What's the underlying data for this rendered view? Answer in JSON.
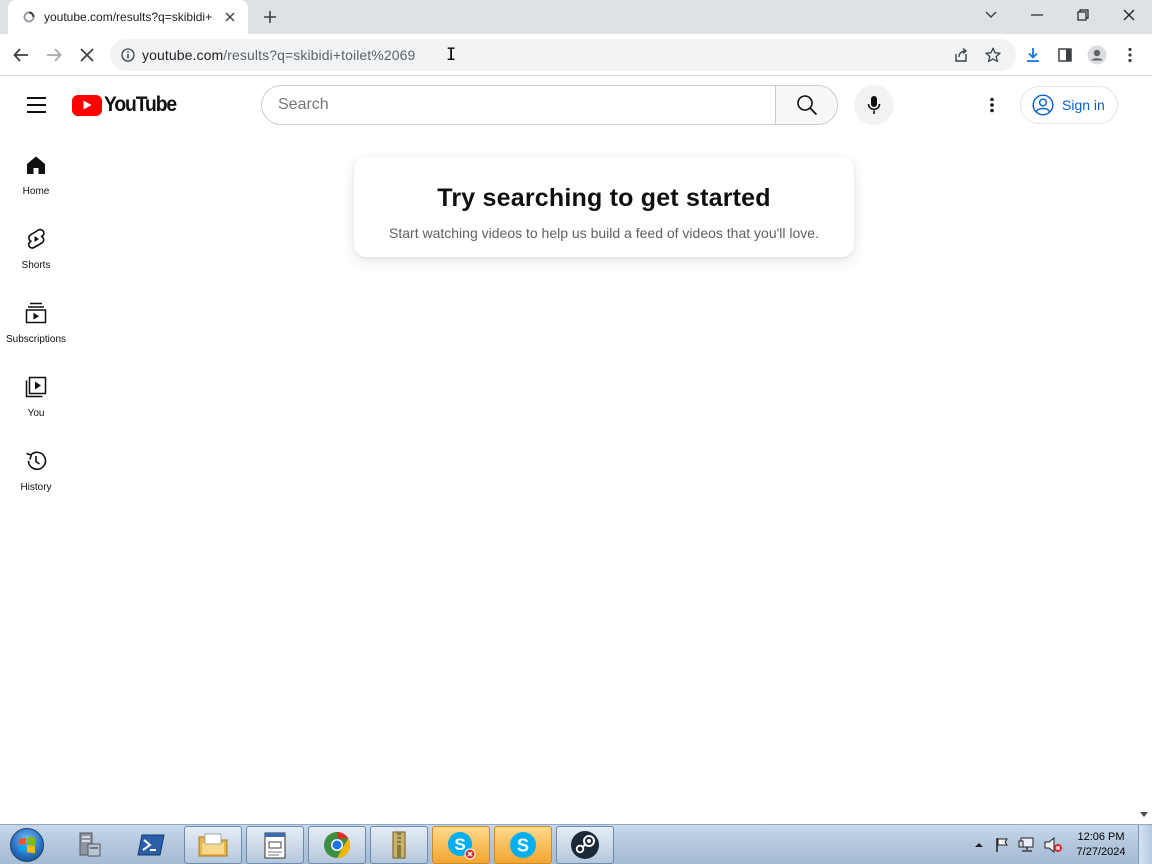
{
  "browser": {
    "tab": {
      "title": "youtube.com/results?q=skibidi+",
      "favicon": "loading-icon"
    },
    "url": {
      "host": "youtube.com",
      "path": "/results?q=skibidi+toilet%2069"
    }
  },
  "youtube": {
    "logo_text": "YouTube",
    "search": {
      "placeholder": "Search",
      "value": ""
    },
    "signin_label": "Sign in",
    "guide": [
      {
        "label": "Home",
        "icon": "home-icon"
      },
      {
        "label": "Shorts",
        "icon": "shorts-icon"
      },
      {
        "label": "Subscriptions",
        "icon": "subscriptions-icon"
      },
      {
        "label": "You",
        "icon": "you-icon"
      },
      {
        "label": "History",
        "icon": "history-icon"
      }
    ],
    "promo": {
      "heading": "Try searching to get started",
      "subtext": "Start watching videos to help us build a feed of videos that you'll love."
    }
  },
  "taskbar": {
    "apps": [
      {
        "name": "server-manager-icon"
      },
      {
        "name": "powershell-icon"
      },
      {
        "name": "file-explorer-icon"
      },
      {
        "name": "notepad-icon"
      },
      {
        "name": "chrome-icon"
      },
      {
        "name": "archive-icon"
      },
      {
        "name": "skype-icon"
      },
      {
        "name": "skype-icon"
      },
      {
        "name": "steam-icon"
      }
    ],
    "clock": {
      "time": "12:06 PM",
      "date": "7/27/2024"
    }
  },
  "colors": {
    "yt_red": "#ff0000",
    "link_blue": "#065fd4",
    "chrome_tabstrip": "#dee1e6"
  }
}
